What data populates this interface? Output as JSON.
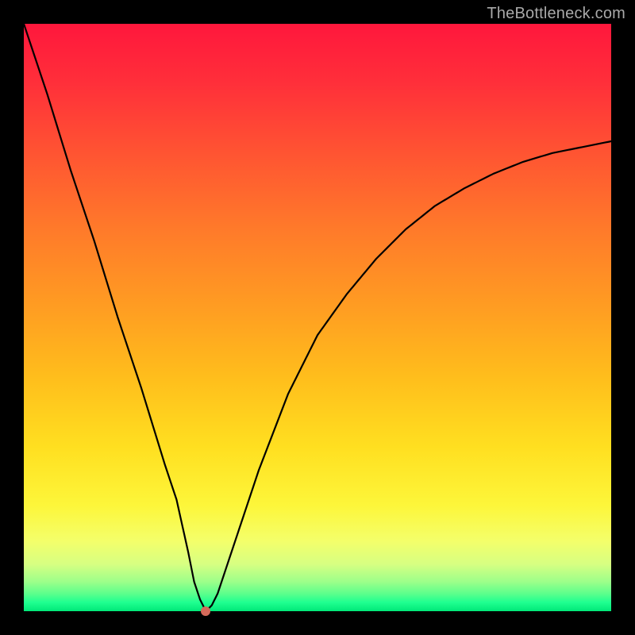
{
  "watermark": "TheBottleneck.com",
  "colors": {
    "frame": "#000000",
    "curve": "#000000",
    "marker": "#d46a5a",
    "gradient_top": "#ff173c",
    "gradient_bottom": "#00e878"
  },
  "chart_data": {
    "type": "line",
    "title": "",
    "xlabel": "",
    "ylabel": "",
    "xlim": [
      0,
      100
    ],
    "ylim": [
      0,
      100
    ],
    "grid": false,
    "legend": false,
    "notes": "Bottleneck-style plot: y is ~percentage mismatch; curve dips to ~0 at x≈31 then rises asymptotically toward ~80. Background gradient encodes y (red=high, green=low). Single marker at the minimum.",
    "series": [
      {
        "name": "curve",
        "x": [
          0,
          4,
          8,
          12,
          16,
          20,
          24,
          26,
          28,
          29,
          30,
          31,
          32,
          33,
          34,
          36,
          40,
          45,
          50,
          55,
          60,
          65,
          70,
          75,
          80,
          85,
          90,
          95,
          100
        ],
        "values": [
          100,
          88,
          75,
          63,
          50,
          38,
          25,
          19,
          10,
          5,
          2,
          0,
          1,
          3,
          6,
          12,
          24,
          37,
          47,
          54,
          60,
          65,
          69,
          72,
          74.5,
          76.5,
          78,
          79,
          80
        ]
      }
    ],
    "marker": {
      "x": 31,
      "y": 0
    }
  }
}
